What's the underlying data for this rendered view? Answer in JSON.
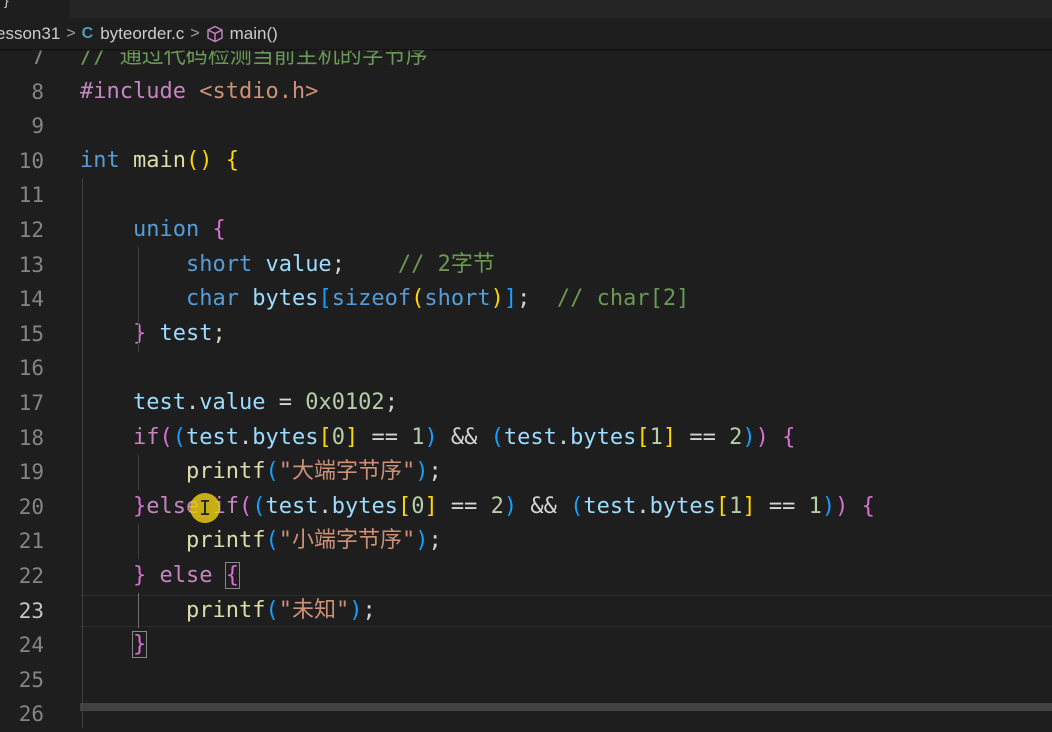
{
  "tab": {
    "text": "}"
  },
  "breadcrumb": {
    "folder": "esson31",
    "file_icon": "C",
    "file": "byteorder.c",
    "symbol_icon": "cube-icon",
    "symbol": "main()",
    "separator": ">"
  },
  "editor": {
    "active_line": 23,
    "lines": [
      {
        "n": "7",
        "text": "// 通过代码检测当前主机的字节序"
      },
      {
        "n": "8",
        "text": "#include <stdio.h>"
      },
      {
        "n": "9",
        "text": ""
      },
      {
        "n": "10",
        "text": "int main() {"
      },
      {
        "n": "11",
        "text": ""
      },
      {
        "n": "12",
        "text": "    union {"
      },
      {
        "n": "13",
        "text": "        short value;    // 2字节"
      },
      {
        "n": "14",
        "text": "        char bytes[sizeof(short)];  // char[2]"
      },
      {
        "n": "15",
        "text": "    } test;"
      },
      {
        "n": "16",
        "text": ""
      },
      {
        "n": "17",
        "text": "    test.value = 0x0102;"
      },
      {
        "n": "18",
        "text": "    if((test.bytes[0] == 1) && (test.bytes[1] == 2)) {"
      },
      {
        "n": "19",
        "text": "        printf(\"大端字节序\");"
      },
      {
        "n": "20",
        "text": "    }else if((test.bytes[0] == 2) && (test.bytes[1] == 1)) {"
      },
      {
        "n": "21",
        "text": "        printf(\"小端字节序\");"
      },
      {
        "n": "22",
        "text": "    } else {"
      },
      {
        "n": "23",
        "text": "        printf(\"未知\");"
      },
      {
        "n": "24",
        "text": "    }"
      },
      {
        "n": "25",
        "text": ""
      },
      {
        "n": "26",
        "text": ""
      }
    ]
  },
  "colors": {
    "background": "#1e1e1e",
    "keyword": "#569cd6",
    "control": "#c586c0",
    "function": "#dcdcaa",
    "variable": "#9cdcfe",
    "number": "#b5cea8",
    "string": "#ce9178",
    "comment": "#6a9955",
    "cursor_highlight": "#e6c814"
  }
}
